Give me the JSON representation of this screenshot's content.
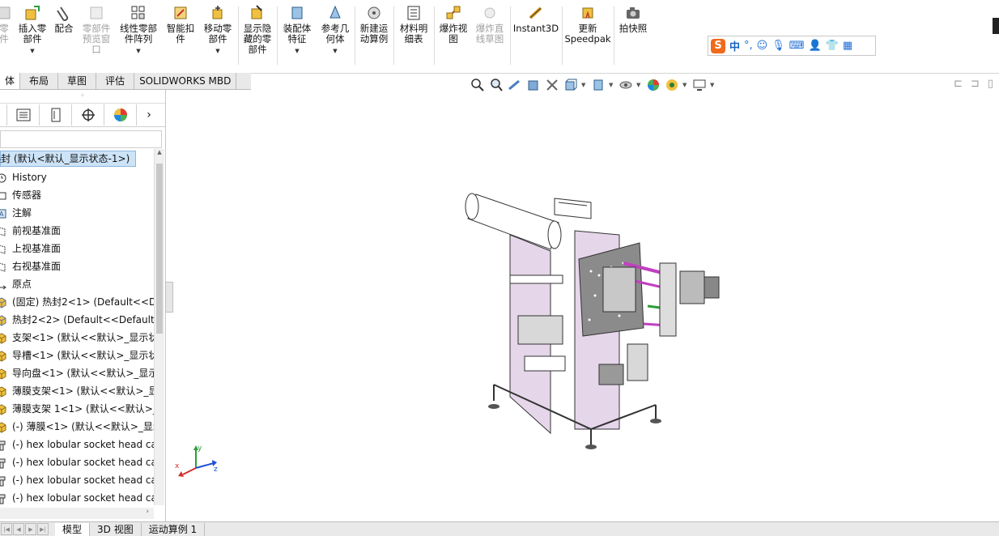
{
  "ribbon": {
    "buttons": [
      {
        "label": "零\n件",
        "icon": "new-part-icon",
        "disabled": true
      },
      {
        "label": "插入零\n部件",
        "icon": "insert-component-icon"
      },
      {
        "label": "配合",
        "icon": "mate-icon"
      },
      {
        "label": "零部件\n预览窗\n口",
        "icon": "preview-window-icon",
        "disabled": true
      },
      {
        "label": "线性零部\n件阵列",
        "icon": "linear-pattern-icon"
      },
      {
        "label": "智能扣\n件",
        "icon": "smart-fasteners-icon"
      },
      {
        "label": "移动零\n部件",
        "icon": "move-component-icon"
      },
      {
        "label": "显示隐\n藏的零\n部件",
        "icon": "show-hidden-icon"
      },
      {
        "label": "装配体\n特征",
        "icon": "assembly-features-icon"
      },
      {
        "label": "参考几\n何体",
        "icon": "reference-geometry-icon"
      },
      {
        "label": "新建运\n动算例",
        "icon": "new-motion-study-icon"
      },
      {
        "label": "材料明\n细表",
        "icon": "bill-of-materials-icon"
      },
      {
        "label": "爆炸视\n图",
        "icon": "exploded-view-icon"
      },
      {
        "label": "爆炸直\n线草图",
        "icon": "explode-line-sketch-icon",
        "disabled": true
      },
      {
        "label": "Instant3D",
        "icon": "instant3d-icon"
      },
      {
        "label": "更新\nSpeedpak",
        "icon": "speedpak-icon"
      },
      {
        "label": "拍快照",
        "icon": "snapshot-icon"
      }
    ]
  },
  "ime": {
    "logo": "S",
    "mode": "中",
    "punct": "°,"
  },
  "tabs": [
    "体",
    "布局",
    "草图",
    "评估",
    "SOLIDWORKS MBD"
  ],
  "tree": {
    "root": "热封 (默认<默认_显示状态-1>)",
    "items": [
      {
        "label": "History",
        "icon": "history-icon"
      },
      {
        "label": "传感器",
        "icon": "sensor-icon"
      },
      {
        "label": "注解",
        "icon": "annotation-icon"
      },
      {
        "label": "前视基准面",
        "icon": "plane-icon"
      },
      {
        "label": "上视基准面",
        "icon": "plane-icon"
      },
      {
        "label": "右视基准面",
        "icon": "plane-icon"
      },
      {
        "label": "原点",
        "icon": "origin-icon"
      },
      {
        "label": "(固定) 热封2<1> (Default<<De",
        "icon": "subassembly-icon"
      },
      {
        "label": "热封2<2> (Default<<Default>",
        "icon": "subassembly-icon"
      },
      {
        "label": "支架<1> (默认<<默认>_显示状",
        "icon": "part-icon"
      },
      {
        "label": "导槽<1> (默认<<默认>_显示状",
        "icon": "part-icon"
      },
      {
        "label": "导向盘<1> (默认<<默认>_显示",
        "icon": "part-icon"
      },
      {
        "label": "薄膜支架<1> (默认<<默认>_显",
        "icon": "part-icon"
      },
      {
        "label": "薄膜支架 1<1> (默认<<默认>_",
        "icon": "part-icon"
      },
      {
        "label": "(-) 薄膜<1> (默认<<默认>_显示",
        "icon": "part-icon"
      },
      {
        "label": "(-) hex lobular socket head ca",
        "icon": "screw-icon"
      },
      {
        "label": "(-) hex lobular socket head ca",
        "icon": "screw-icon"
      },
      {
        "label": "(-) hex lobular socket head ca",
        "icon": "screw-icon"
      },
      {
        "label": "(-) hex lobular socket head ca",
        "icon": "screw-icon"
      }
    ]
  },
  "bottom_tabs": [
    "模型",
    "3D 视图",
    "运动算例 1"
  ],
  "colors": {
    "accent": "#1e6fd9",
    "selection": "#cde3f7",
    "frame": "#e6d6ea"
  }
}
